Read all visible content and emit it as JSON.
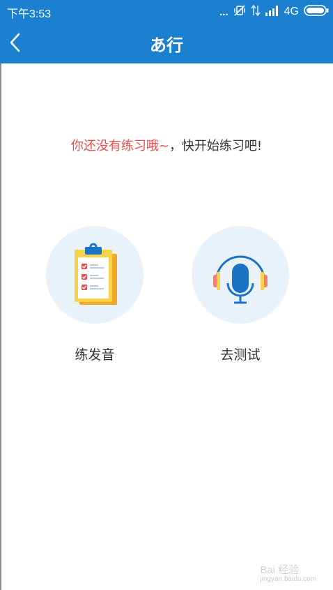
{
  "status_bar": {
    "time": "下午3:53",
    "dots": "...",
    "network": "4G",
    "icons": [
      "vibrate-off-icon",
      "data-transfer-icon",
      "signal-icon",
      "battery-icon"
    ]
  },
  "nav": {
    "title": "あ行",
    "back_icon": "chevron-left-icon"
  },
  "message": {
    "highlight": "你还没有练习哦~",
    "rest": "，快开始练习吧!"
  },
  "actions": [
    {
      "label": "练发音",
      "icon": "clipboard-checklist-icon"
    },
    {
      "label": "去测试",
      "icon": "headset-microphone-icon"
    }
  ],
  "watermark": {
    "main": "Bai 经验",
    "sub": "jingyan.baidu.com"
  },
  "colors": {
    "primary": "#1a80cf",
    "highlight_text": "#ee4b4b",
    "circle_bg": "#e9f2f9"
  }
}
